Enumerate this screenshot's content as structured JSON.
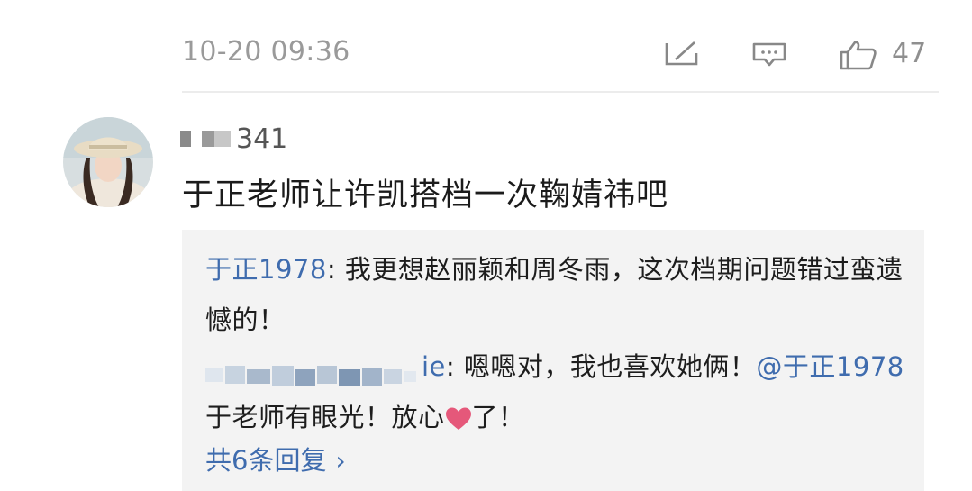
{
  "comment": {
    "timestamp": "10-20 09:36",
    "like_count": "47",
    "username_suffix": "341",
    "text": "于正老师让许凯搭档一次鞠婧祎吧",
    "actions": {
      "reply_icon": "edit-icon",
      "message_icon": "comment-icon",
      "like_icon": "thumbs-up-icon"
    }
  },
  "replies": {
    "items": [
      {
        "author": "于正1978",
        "separator": ": ",
        "text": "我更想赵丽颖和周冬雨，这次档期问题错过蛮遗憾的！"
      },
      {
        "author_suffix": "ie",
        "separator": ": ",
        "text_before_mention": "嗯嗯对，我也喜欢她俩！",
        "mention": "@于正1978",
        "text_after_mention": " 于老师有眼光！放心",
        "heart_icon": "heart-icon",
        "text_end": "了！"
      }
    ],
    "more_label": "共6条回复",
    "more_chevron": "›"
  },
  "colors": {
    "link": "#3f6cae",
    "timestamp": "#9a9a9a",
    "reply_bg": "#f3f3f3",
    "heart": "#e5587a"
  }
}
